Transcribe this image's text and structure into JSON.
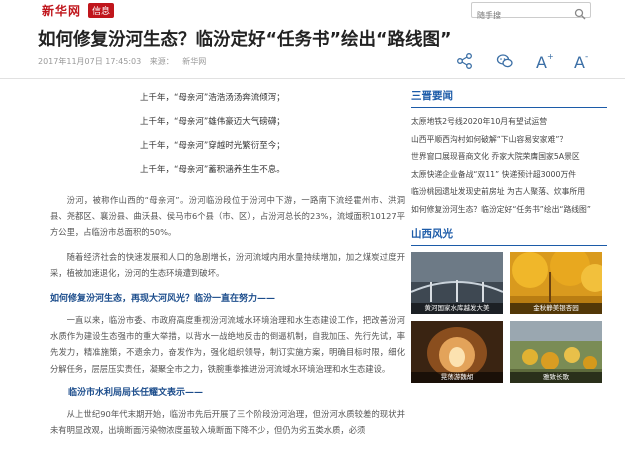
{
  "site": {
    "logo": "新华网",
    "badge": "信息",
    "search_placeholder": "随手搜"
  },
  "article": {
    "title": "如何修复汾河生态？临汾定好“任务书”绘出“路线图”",
    "date": "2017年11月07日 17:45:03",
    "source_label": "来源：",
    "source": "新华网",
    "poem": [
      "上千年，“母亲河”浩浩汤汤奔流倾泻；",
      "上千年，“母亲河”雄伟豪迈大气磅礴；",
      "上千年，“母亲河”穿越时光繁衍至今；",
      "上千年，“母亲河”蓄积涵养生生不息。"
    ],
    "para1": "汾河，被称作山西的“母亲河”。汾河临汾段位于汾河中下游，一路南下流经霍州市、洪洞县、尧都区、襄汾县、曲沃县、侯马市6个县（市、区），占汾河总长的23%，流域面积10127平方公里，占临汾市总面积的50%。",
    "para2": "随着经济社会的快速发展和人口的急剧增长，汾河流域内用水量持续增加，加之煤炭过度开采，植被加速退化，汾河的生态环境遭到破坏。",
    "subhead1": "如何修复汾河生态，再现大河风光？临汾一直在努力——",
    "para3": "一直以来，临汾市委、市政府高度重视汾河流域水环境治理和水生态建设工作，把改善汾河水质作为建设生态强市的重大举措，以背水一战绝地反击的倒逼机制，自我加压、先行先试，率先发力，精准施策，不遗余力，奋发作为，强化组织领导，制订实施方案，明确目标时限，细化分解任务，层层压实责任，凝聚全市之力，铁腕重拳推进汾河流域水环境治理和水生态建设。",
    "subhead2": "临汾市水利局局长任耀文表示——",
    "para4": "从上世纪90年代末期开始，临汾市先后开展了三个阶段汾河治理，但汾河水质较差的现状并未有明显改观，出境断面污染物浓度虽较入境断面下降不少，但仍为劣五类水质，必须"
  },
  "sidebar": {
    "section1_title": "三晋要闻",
    "news": [
      "太原地铁2号线2020年10月有望试运营",
      "山西平顺西沟村如何破解“下山容易安家难”？",
      "世界窗口展现晋商文化 乔家大院荣膺国家5A景区",
      "太原快递企业备战“双11” 快递预计超3000万件",
      "临汾桃园遗址发现史前房址 为古人聚落、炊事所用",
      "如何修复汾河生态？临汾定好“任务书”绘出“路线图”"
    ],
    "section2_title": "山西风光",
    "photos": [
      {
        "name": "photo-yellow-river-bridge",
        "caption": "黄河国家水库越发大美"
      },
      {
        "name": "photo-autumn-ginkgo",
        "caption": "金秋静美银杏园"
      },
      {
        "name": "photo-mine-tunnel",
        "caption": "晃荡游魏胡"
      },
      {
        "name": "photo-harvest",
        "caption": "雅致长歌"
      }
    ]
  },
  "colors": {
    "brand_red": "#c0161c",
    "link_blue": "#1c5ba8",
    "subhead_blue": "#1c4d8c"
  },
  "icons": [
    "share-icon",
    "wechat-icon",
    "font-increase-icon",
    "font-decrease-icon",
    "search-icon"
  ]
}
